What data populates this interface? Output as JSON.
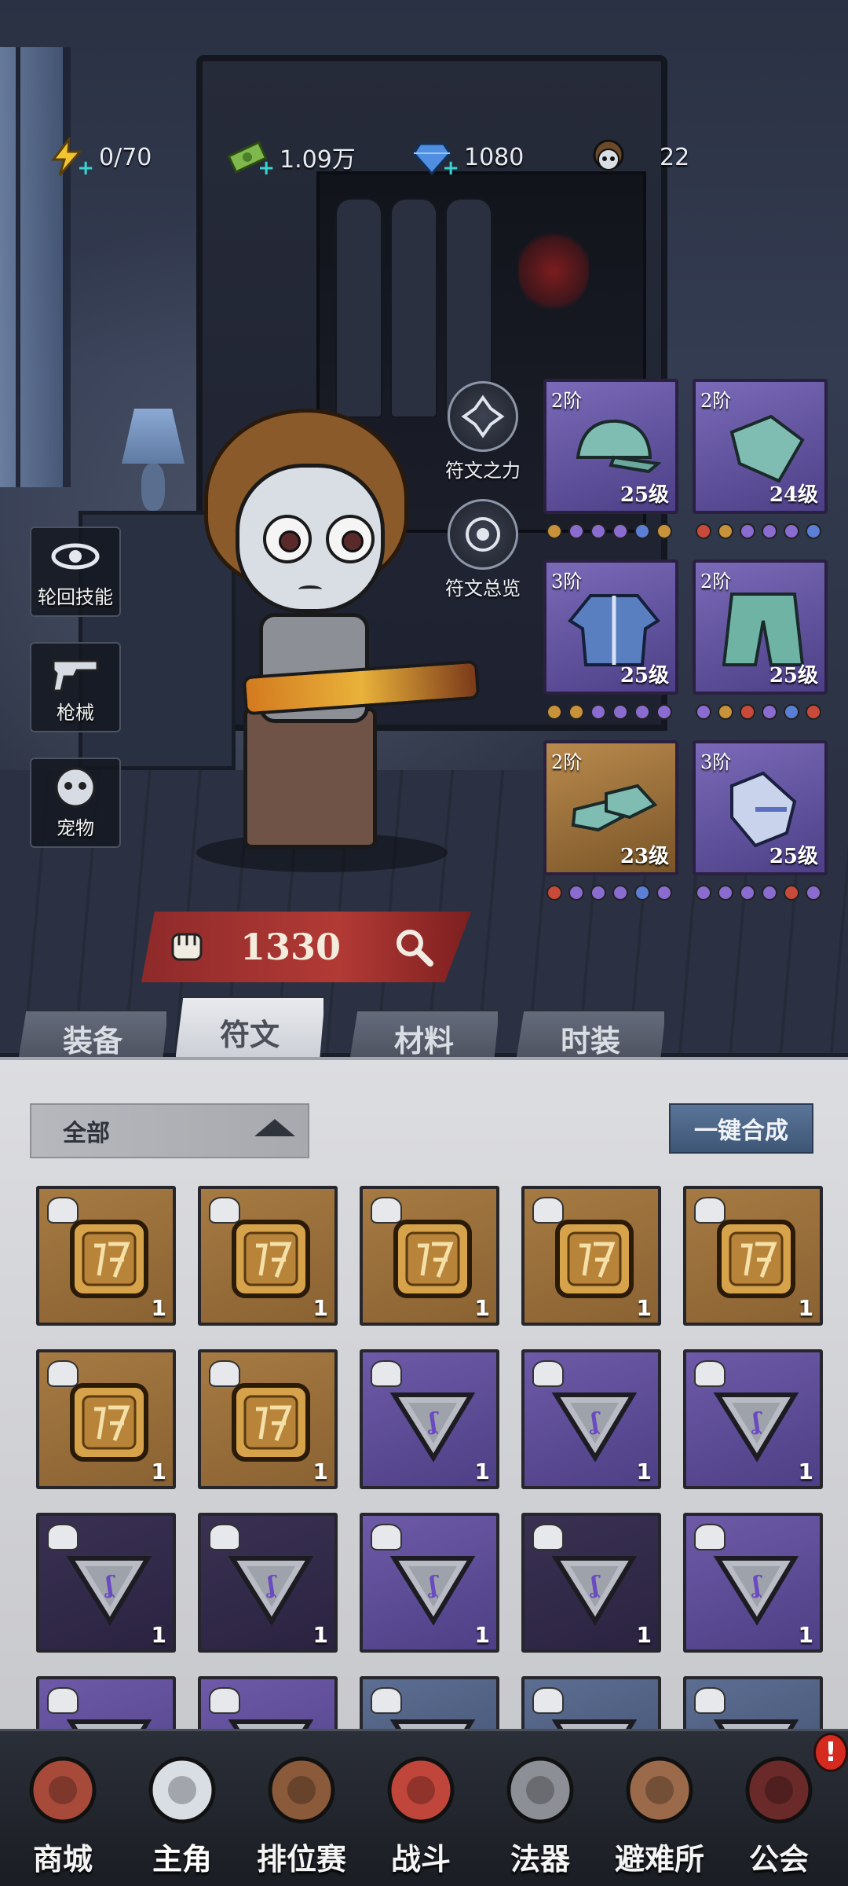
{
  "resources": {
    "stamina": {
      "value": "0/70",
      "icon": "lightning-icon"
    },
    "cash": {
      "value": "1.09万",
      "icon": "cash-icon"
    },
    "gems": {
      "value": "1080",
      "icon": "diamond-icon"
    },
    "avatar": {
      "value": "22",
      "icon": "avatar-icon"
    }
  },
  "side_buttons": [
    {
      "label": "轮回技能",
      "icon": "eye-swirl-icon"
    },
    {
      "label": "枪械",
      "icon": "revolver-icon"
    },
    {
      "label": "宠物",
      "icon": "ghost-pet-icon"
    }
  ],
  "rune_buttons": [
    {
      "label": "符文之力",
      "icon": "rune-power-icon"
    },
    {
      "label": "符文总览",
      "icon": "rune-overview-icon"
    }
  ],
  "equipment": [
    {
      "tier": "2阶",
      "level": "25级",
      "item": "cap",
      "rarity": "purple",
      "dots": [
        "#c7923a",
        "#8a6bd0",
        "#8a6bd0",
        "#8a6bd0",
        "#5b7fd6",
        "#c7923a"
      ]
    },
    {
      "tier": "2阶",
      "level": "24级",
      "item": "scarf",
      "rarity": "purple",
      "dots": [
        "#c74a3a",
        "#c7923a",
        "#8a6bd0",
        "#8a6bd0",
        "#8a6bd0",
        "#5b7fd6"
      ]
    },
    {
      "tier": "3阶",
      "level": "25级",
      "item": "jacket",
      "rarity": "purple",
      "dots": [
        "#c7923a",
        "#c7923a",
        "#8a6bd0",
        "#8a6bd0",
        "#8a6bd0",
        "#8a6bd0"
      ]
    },
    {
      "tier": "2阶",
      "level": "25级",
      "item": "pants",
      "rarity": "purple",
      "dots": [
        "#8a6bd0",
        "#c7923a",
        "#c74a3a",
        "#8a6bd0",
        "#5b7fd6",
        "#c74a3a"
      ]
    },
    {
      "tier": "2阶",
      "level": "23级",
      "item": "shoes",
      "rarity": "orange",
      "dots": [
        "#c74a3a",
        "#8a6bd0",
        "#8a6bd0",
        "#8a6bd0",
        "#5b7fd6",
        "#8a6bd0"
      ]
    },
    {
      "tier": "3阶",
      "level": "25级",
      "item": "glove",
      "rarity": "purple",
      "dots": [
        "#8a6bd0",
        "#8a6bd0",
        "#8a6bd0",
        "#8a6bd0",
        "#c74a3a",
        "#8a6bd0"
      ]
    }
  ],
  "power": {
    "value": "1330"
  },
  "tabs": [
    "装备",
    "符文",
    "材料",
    "时装"
  ],
  "active_tab": 1,
  "filter": {
    "label": "全部"
  },
  "synth_button": "一键合成",
  "inventory": [
    {
      "rarity": "gold",
      "count": "1"
    },
    {
      "rarity": "gold",
      "count": "1"
    },
    {
      "rarity": "gold",
      "count": "1"
    },
    {
      "rarity": "gold",
      "count": "1"
    },
    {
      "rarity": "gold",
      "count": "1"
    },
    {
      "rarity": "gold",
      "count": "1"
    },
    {
      "rarity": "gold",
      "count": "1"
    },
    {
      "rarity": "violet",
      "count": "1"
    },
    {
      "rarity": "violet",
      "count": "1"
    },
    {
      "rarity": "violet",
      "count": "1"
    },
    {
      "rarity": "dark",
      "count": "1"
    },
    {
      "rarity": "dark",
      "count": "1"
    },
    {
      "rarity": "violet",
      "count": "1"
    },
    {
      "rarity": "dark",
      "count": "1"
    },
    {
      "rarity": "violet",
      "count": "1"
    },
    {
      "rarity": "violet",
      "count": ""
    },
    {
      "rarity": "violet",
      "count": ""
    },
    {
      "rarity": "blue",
      "count": ""
    },
    {
      "rarity": "blue",
      "count": ""
    },
    {
      "rarity": "blue",
      "count": ""
    }
  ],
  "nav": [
    {
      "label": "商城",
      "icon": "shop-icon"
    },
    {
      "label": "主角",
      "icon": "hero-icon"
    },
    {
      "label": "排位赛",
      "icon": "ranked-icon"
    },
    {
      "label": "战斗",
      "icon": "battle-icon"
    },
    {
      "label": "法器",
      "icon": "artifact-icon"
    },
    {
      "label": "避难所",
      "icon": "shelter-icon"
    },
    {
      "label": "公会",
      "icon": "guild-icon"
    }
  ],
  "nav_active": 1,
  "guild_badge": "!"
}
